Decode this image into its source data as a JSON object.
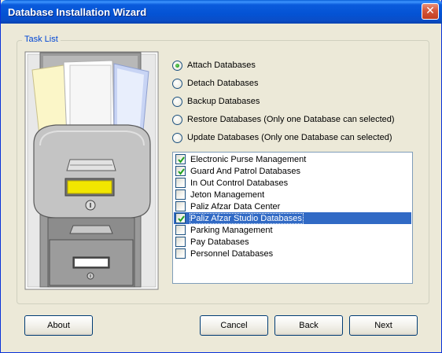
{
  "window": {
    "title": "Database Installation Wizard"
  },
  "icons": {
    "close": "close-icon",
    "illustration": "file-cabinet-icon"
  },
  "task_list": {
    "label": "Task List",
    "options": [
      {
        "label": "Attach Databases",
        "checked": true
      },
      {
        "label": "Detach Databases",
        "checked": false
      },
      {
        "label": "Backup Databases",
        "checked": false
      },
      {
        "label": "Restore Databases (Only one Database can selected)",
        "checked": false
      },
      {
        "label": "Update Databases (Only one Database can selected)",
        "checked": false
      }
    ]
  },
  "databases": {
    "items": [
      {
        "label": "Electronic Purse Management",
        "checked": true,
        "selected": false
      },
      {
        "label": "Guard And Patrol Databases",
        "checked": true,
        "selected": false
      },
      {
        "label": "In Out Control Databases",
        "checked": false,
        "selected": false
      },
      {
        "label": "Jeton Management",
        "checked": false,
        "selected": false
      },
      {
        "label": "Paliz Afzar Data Center",
        "checked": false,
        "selected": false
      },
      {
        "label": "Paliz Afzar Studio Databases",
        "checked": true,
        "selected": true
      },
      {
        "label": "Parking Management",
        "checked": false,
        "selected": false
      },
      {
        "label": "Pay Databases",
        "checked": false,
        "selected": false
      },
      {
        "label": "Personnel Databases",
        "checked": false,
        "selected": false
      }
    ]
  },
  "buttons": {
    "about": "About",
    "cancel": "Cancel",
    "back": "Back",
    "next": "Next"
  },
  "colors": {
    "titlebar": "#0453d4",
    "selection": "#316ac5",
    "group_label": "#0046d5"
  }
}
